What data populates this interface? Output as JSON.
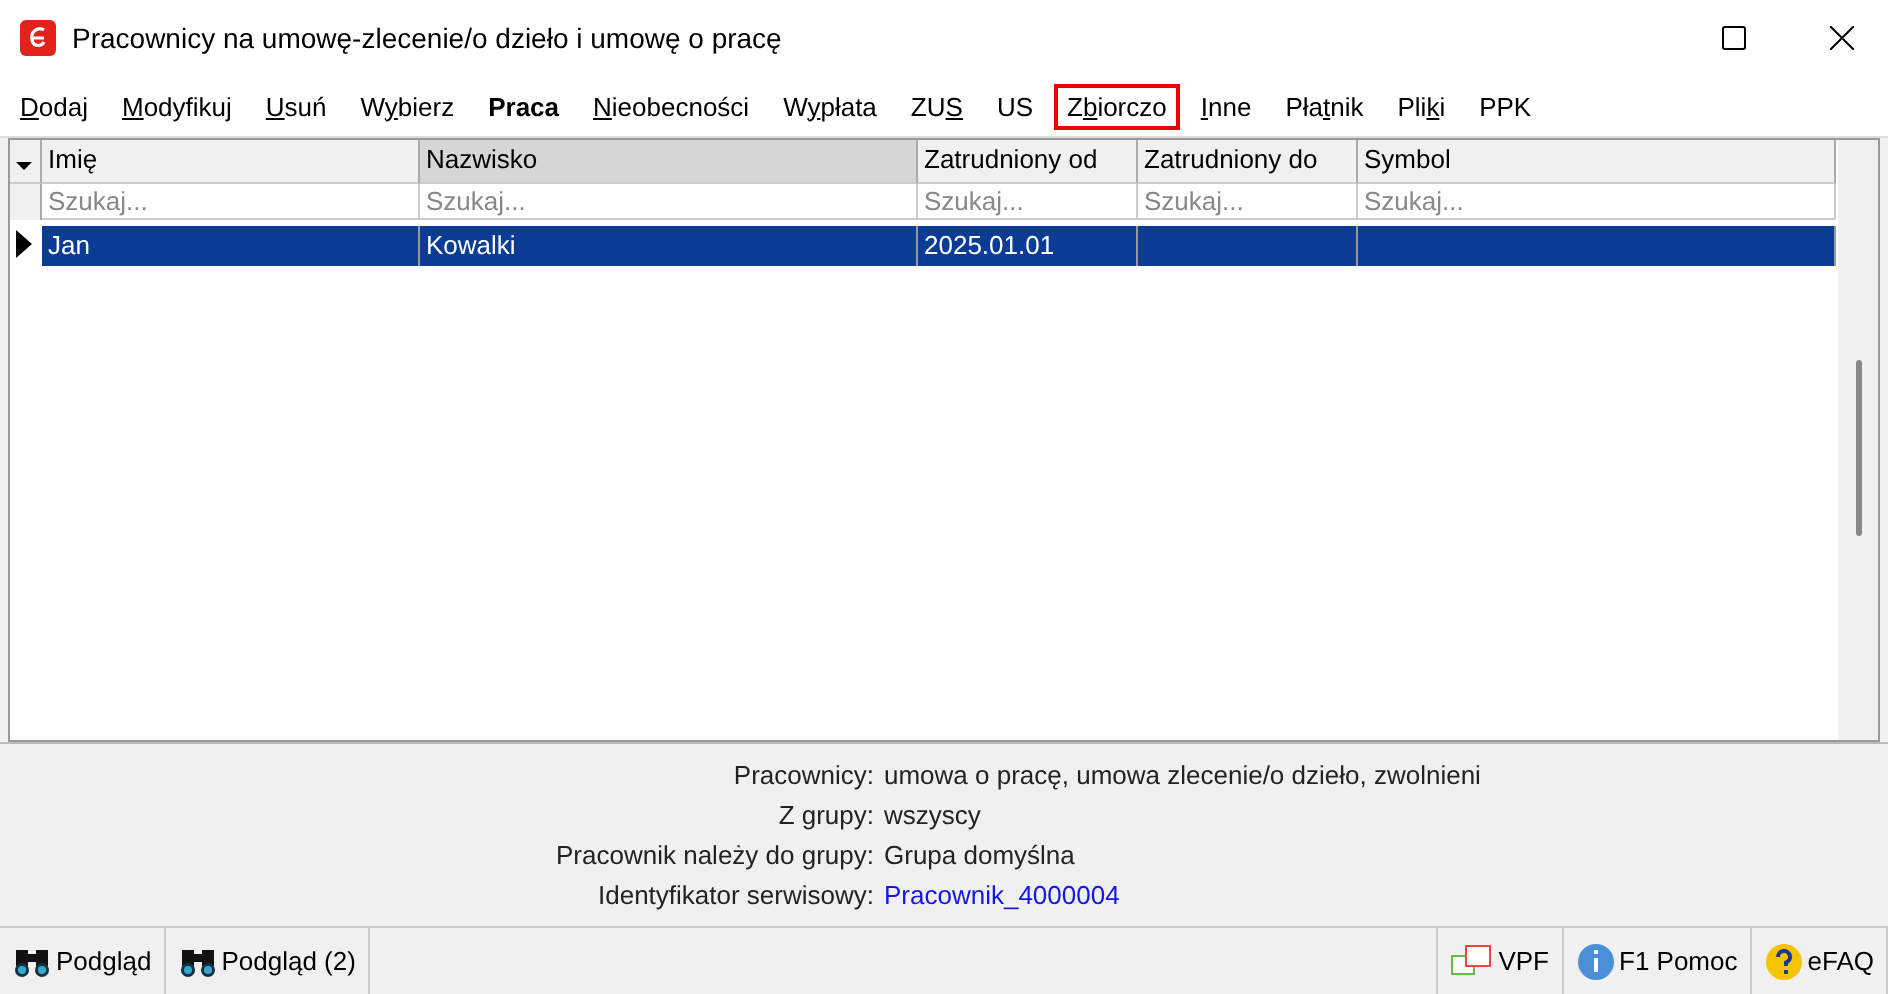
{
  "window": {
    "title": "Pracownicy na umowę-zlecenie/o dzieło i umowę o pracę"
  },
  "menu": [
    {
      "key": "D",
      "post": "odaj",
      "bold": false,
      "highlighted": false
    },
    {
      "key": "M",
      "post": "odyfikuj",
      "bold": false,
      "highlighted": false
    },
    {
      "key": "U",
      "post": "suń",
      "bold": false,
      "highlighted": false
    },
    {
      "pre": "W",
      "key": "y",
      "post": "bierz",
      "bold": false,
      "highlighted": false
    },
    {
      "pre": "Praca",
      "bold": true,
      "highlighted": false
    },
    {
      "key": "N",
      "post": "ieobecności",
      "bold": false,
      "highlighted": false
    },
    {
      "pre": "W",
      "key": "y",
      "post": "płata",
      "bold": false,
      "highlighted": false
    },
    {
      "pre": "ZU",
      "key": "S",
      "bold": false,
      "highlighted": false
    },
    {
      "pre": "US",
      "bold": false,
      "highlighted": false
    },
    {
      "pre": "Z",
      "key": "b",
      "post": "iorczo",
      "bold": false,
      "highlighted": true
    },
    {
      "key": "I",
      "post": "nne",
      "bold": false,
      "highlighted": false
    },
    {
      "pre": "Pła",
      "key": "t",
      "post": "nik",
      "bold": false,
      "highlighted": false
    },
    {
      "pre": "Pli",
      "key": "k",
      "post": "i",
      "bold": false,
      "highlighted": false
    },
    {
      "pre": "PPK",
      "bold": false,
      "highlighted": false
    }
  ],
  "table": {
    "columns": [
      {
        "label": "Imię",
        "sorted": false,
        "placeholder": "Szukaj..."
      },
      {
        "label": "Nazwisko",
        "sorted": true,
        "placeholder": "Szukaj..."
      },
      {
        "label": "Zatrudniony od",
        "sorted": false,
        "placeholder": "Szukaj..."
      },
      {
        "label": "Zatrudniony do",
        "sorted": false,
        "placeholder": "Szukaj..."
      },
      {
        "label": "Symbol",
        "sorted": false,
        "placeholder": "Szukaj..."
      }
    ],
    "rows": [
      {
        "selected": true,
        "cells": [
          "Jan",
          "Kowalki",
          "2025.01.01",
          null,
          null
        ]
      }
    ]
  },
  "info": [
    {
      "label": "Pracownicy:",
      "value": "umowa o pracę, umowa zlecenie/o dzieło, zwolnieni",
      "link": false
    },
    {
      "label": "Z grupy:",
      "value": "wszyscy",
      "link": false
    },
    {
      "label": "Pracownik należy do grupy:",
      "value": "Grupa domyślna",
      "link": false
    },
    {
      "label": "Identyfikator serwisowy:",
      "value": "Pracownik_4000004",
      "link": true
    }
  ],
  "status_bar": {
    "left": [
      "Podgląd",
      "Podgląd (2)"
    ],
    "right": [
      {
        "kind": "vpf",
        "label": "VPF"
      },
      {
        "kind": "info",
        "label": "F1 Pomoc"
      },
      {
        "kind": "help",
        "label": "eFAQ"
      }
    ]
  }
}
